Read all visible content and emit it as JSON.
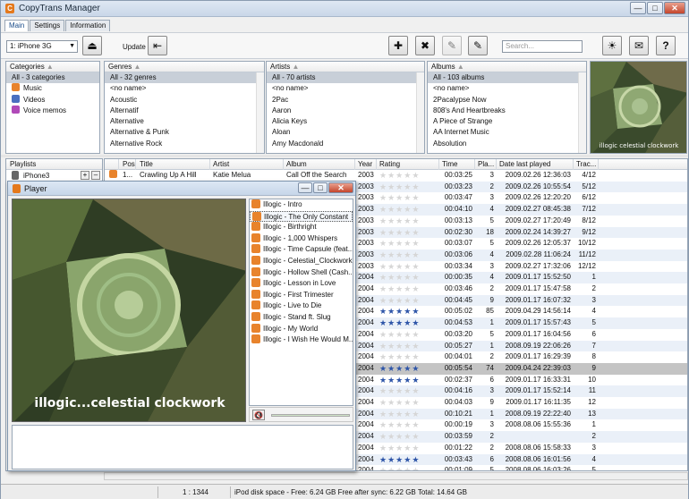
{
  "window": {
    "title": "CopyTrans Manager"
  },
  "tabs": [
    "Main",
    "Settings",
    "Information"
  ],
  "toolbar": {
    "device": "1: iPhone 3G",
    "update_label": "Update",
    "search_placeholder": "Search..."
  },
  "categories": {
    "header": "Categories",
    "items": [
      "All - 3 categories",
      "Music",
      "Videos",
      "Voice memos"
    ]
  },
  "genres": {
    "header": "Genres",
    "items": [
      "All - 32 genres",
      "<no name>",
      "Acoustic",
      "Alternatif",
      "Alternative",
      "Alternative & Punk",
      "Alternative Rock"
    ]
  },
  "artists": {
    "header": "Artists",
    "items": [
      "All - 70 artists",
      "<no name>",
      "2Pac",
      "Aaron",
      "Alicia Keys",
      "Aloan",
      "Amy Macdonald"
    ]
  },
  "albums": {
    "header": "Albums",
    "items": [
      "All - 103 albums",
      "<no name>",
      "2Pacalypse Now",
      "808's And Heartbreaks",
      "A Piece of Strange",
      "AA Internet Music",
      "Absolution"
    ]
  },
  "cover_caption": "illogic celestial clockwork",
  "playlists": {
    "header": "Playlists",
    "device": "iPhone3"
  },
  "columns": [
    "Pos",
    "Title",
    "Artist",
    "Album",
    "Year",
    "Rating",
    "Time",
    "Pla...",
    "Date last played",
    "Trac..."
  ],
  "rows": [
    {
      "pos": "1...",
      "title": "Crawling Up A Hill",
      "artist": "Katie Melua",
      "album": "Call Off the Search",
      "year": "2003",
      "rating": 0,
      "time": "00:03:25",
      "plays": "3",
      "date": "2009.02.26 12:36:03",
      "track": "4/12"
    },
    {
      "year": "2003",
      "rating": 0,
      "time": "00:03:23",
      "plays": "2",
      "date": "2009.02.26 10:55:54",
      "track": "5/12"
    },
    {
      "year": "2003",
      "rating": 0,
      "time": "00:03:47",
      "plays": "3",
      "date": "2009.02.26 12:20:20",
      "track": "6/12"
    },
    {
      "year": "2003",
      "rating": 0,
      "time": "00:04:10",
      "plays": "4",
      "date": "2009.02.27 08:45:38",
      "track": "7/12"
    },
    {
      "year": "2003",
      "rating": 0,
      "time": "00:03:13",
      "plays": "5",
      "date": "2009.02.27 17:20:49",
      "track": "8/12"
    },
    {
      "year": "2003",
      "rating": 0,
      "time": "00:02:30",
      "plays": "18",
      "date": "2009.02.24 14:39:27",
      "track": "9/12"
    },
    {
      "year": "2003",
      "rating": 0,
      "time": "00:03:07",
      "plays": "5",
      "date": "2009.02.26 12:05:37",
      "track": "10/12"
    },
    {
      "year": "2003",
      "rating": 0,
      "time": "00:03:06",
      "plays": "4",
      "date": "2009.02.28 11:06:24",
      "track": "11/12"
    },
    {
      "year": "2003",
      "rating": 0,
      "time": "00:03:34",
      "plays": "3",
      "date": "2009.02.27 17:32:06",
      "track": "12/12"
    },
    {
      "year": "2004",
      "rating": 0,
      "time": "00:00:35",
      "plays": "4",
      "date": "2009.01.17 15:52:50",
      "track": "1"
    },
    {
      "year": "2004",
      "rating": 0,
      "time": "00:03:46",
      "plays": "2",
      "date": "2009.01.17 15:47:58",
      "track": "2"
    },
    {
      "year": "2004",
      "rating": 0,
      "time": "00:04:45",
      "plays": "9",
      "date": "2009.01.17 16:07:32",
      "track": "3"
    },
    {
      "year": "2004",
      "rating": 5,
      "time": "00:05:02",
      "plays": "85",
      "date": "2009.04.29 14:56:14",
      "track": "4"
    },
    {
      "year": "2004",
      "rating": 5,
      "time": "00:04:53",
      "plays": "1",
      "date": "2009.01.17 15:57:43",
      "track": "5"
    },
    {
      "year": "2004",
      "rating": 0,
      "time": "00:03:20",
      "plays": "5",
      "date": "2009.01.17 16:04:56",
      "track": "6"
    },
    {
      "year": "2004",
      "rating": 0,
      "time": "00:05:27",
      "plays": "1",
      "date": "2008.09.19 22:06:26",
      "track": "7"
    },
    {
      "year": "2004",
      "rating": 0,
      "time": "00:04:01",
      "plays": "2",
      "date": "2009.01.17 16:29:39",
      "track": "8"
    },
    {
      "year": "2004",
      "rating": 5,
      "time": "00:05:54",
      "plays": "74",
      "date": "2009.04.24 22:39:03",
      "track": "9",
      "selected": true
    },
    {
      "year": "2004",
      "rating": 5,
      "time": "00:02:37",
      "plays": "6",
      "date": "2009.01.17 16:33:31",
      "track": "10"
    },
    {
      "year": "2004",
      "rating": 0,
      "time": "00:04:16",
      "plays": "3",
      "date": "2009.01.17 15:52:14",
      "track": "11"
    },
    {
      "year": "2004",
      "rating": 0,
      "time": "00:04:03",
      "plays": "9",
      "date": "2009.01.17 16:11:35",
      "track": "12"
    },
    {
      "year": "2004",
      "rating": 0,
      "time": "00:10:21",
      "plays": "1",
      "date": "2008.09.19 22:22:40",
      "track": "13"
    },
    {
      "year": "2004",
      "rating": 0,
      "time": "00:00:19",
      "plays": "3",
      "date": "2008.08.06 15:55:36",
      "track": "1"
    },
    {
      "year": "2004",
      "rating": 0,
      "time": "00:03:59",
      "plays": "2",
      "date": "",
      "track": "2"
    },
    {
      "year": "2004",
      "rating": 0,
      "time": "00:01:22",
      "plays": "2",
      "date": "2008.08.06 15:58:33",
      "track": "3"
    },
    {
      "year": "2004",
      "rating": 5,
      "time": "00:03:43",
      "plays": "6",
      "date": "2008.08.06 16:01:56",
      "track": "4"
    },
    {
      "year": "2004",
      "rating": 0,
      "time": "00:01:09",
      "plays": "5",
      "date": "2008.08.06 16:03:26",
      "track": "5"
    }
  ],
  "player": {
    "title": "Player",
    "tracks": [
      "Illogic - Intro",
      "Illogic - The Only Constant",
      "Illogic - Birthright",
      "Illogic - 1,000 Whispers",
      "Illogic - Time Capsule (feat....",
      "Illogic - Celestial_Clockwork",
      "Illogic - Hollow Shell (Cash...",
      "Illogic - Lesson in Love",
      "Illogic - First Trimester",
      "Illogic - Live to Die",
      "Illogic - Stand ft. Slug",
      "Illogic - My World",
      "Illogic - I Wish He Would M..."
    ],
    "current_index": 1,
    "cover_caption": "illogic...celestial clockwork"
  },
  "status": {
    "count": "1 : 1344",
    "disk": "iPod disk space - Free: 6.24 GB Free after sync: 6.22 GB Total: 14.64 GB"
  },
  "colors": {
    "star_on": "#2e55a8",
    "accent": "#e4791d"
  }
}
